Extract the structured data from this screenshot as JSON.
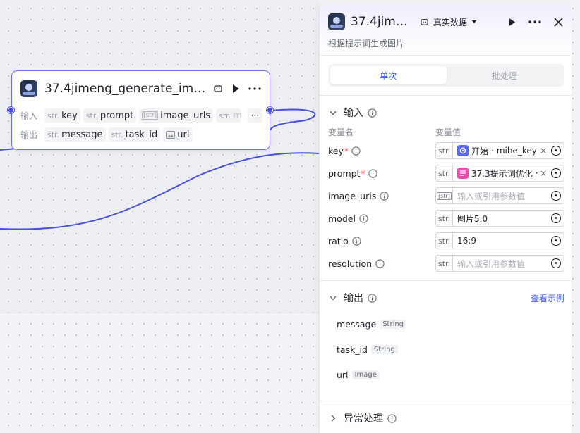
{
  "node": {
    "title": "37.4jimeng_generate_imag···",
    "input_label": "输入",
    "output_label": "输出",
    "inputs": [
      {
        "type": "str.",
        "name": "key"
      },
      {
        "type": "str.",
        "name": "prompt"
      },
      {
        "type": "[str]",
        "name": "image_urls"
      },
      {
        "type": "str.",
        "name": "mo"
      }
    ],
    "more_label": "···",
    "outputs": [
      {
        "type": "str.",
        "name": "message"
      },
      {
        "type": "str.",
        "name": "task_id"
      },
      {
        "type": "image",
        "name": "url"
      }
    ]
  },
  "panel": {
    "title": "37.4jimen···",
    "mode_label": "真实数据",
    "description": "根据提示词生成图片",
    "tabs": [
      {
        "label": "单次",
        "active": true
      },
      {
        "label": "批处理",
        "active": false
      }
    ],
    "input_section": {
      "title": "输入",
      "col_name": "变量名",
      "col_value": "变量值",
      "rows": [
        {
          "name": "key",
          "required": true,
          "type": "str.",
          "ref_source": "开始",
          "ref_var": "mihe_key",
          "ref_color": "#5b6af5",
          "clearable": true
        },
        {
          "name": "prompt",
          "required": true,
          "type": "str.",
          "ref_source": "37.3提示词优化",
          "ref_var": "d",
          "ref_color": "#e84fa8",
          "clearable": true
        },
        {
          "name": "image_urls",
          "required": false,
          "type": "[str]",
          "placeholder": "输入或引用参数值"
        },
        {
          "name": "model",
          "required": false,
          "type": "str.",
          "value": "图片5.0"
        },
        {
          "name": "ratio",
          "required": false,
          "type": "str.",
          "value": "16:9"
        },
        {
          "name": "resolution",
          "required": false,
          "type": "str.",
          "placeholder": "输入或引用参数值"
        }
      ]
    },
    "output_section": {
      "title": "输出",
      "link": "查看示例",
      "rows": [
        {
          "name": "message",
          "type": "String"
        },
        {
          "name": "task_id",
          "type": "String"
        },
        {
          "name": "url",
          "type": "Image"
        }
      ]
    },
    "exception_section": {
      "title": "异常处理"
    }
  },
  "colors": {
    "accent": "#3d5afe",
    "wire": "#4a4fd6",
    "required": "#f54a45"
  }
}
